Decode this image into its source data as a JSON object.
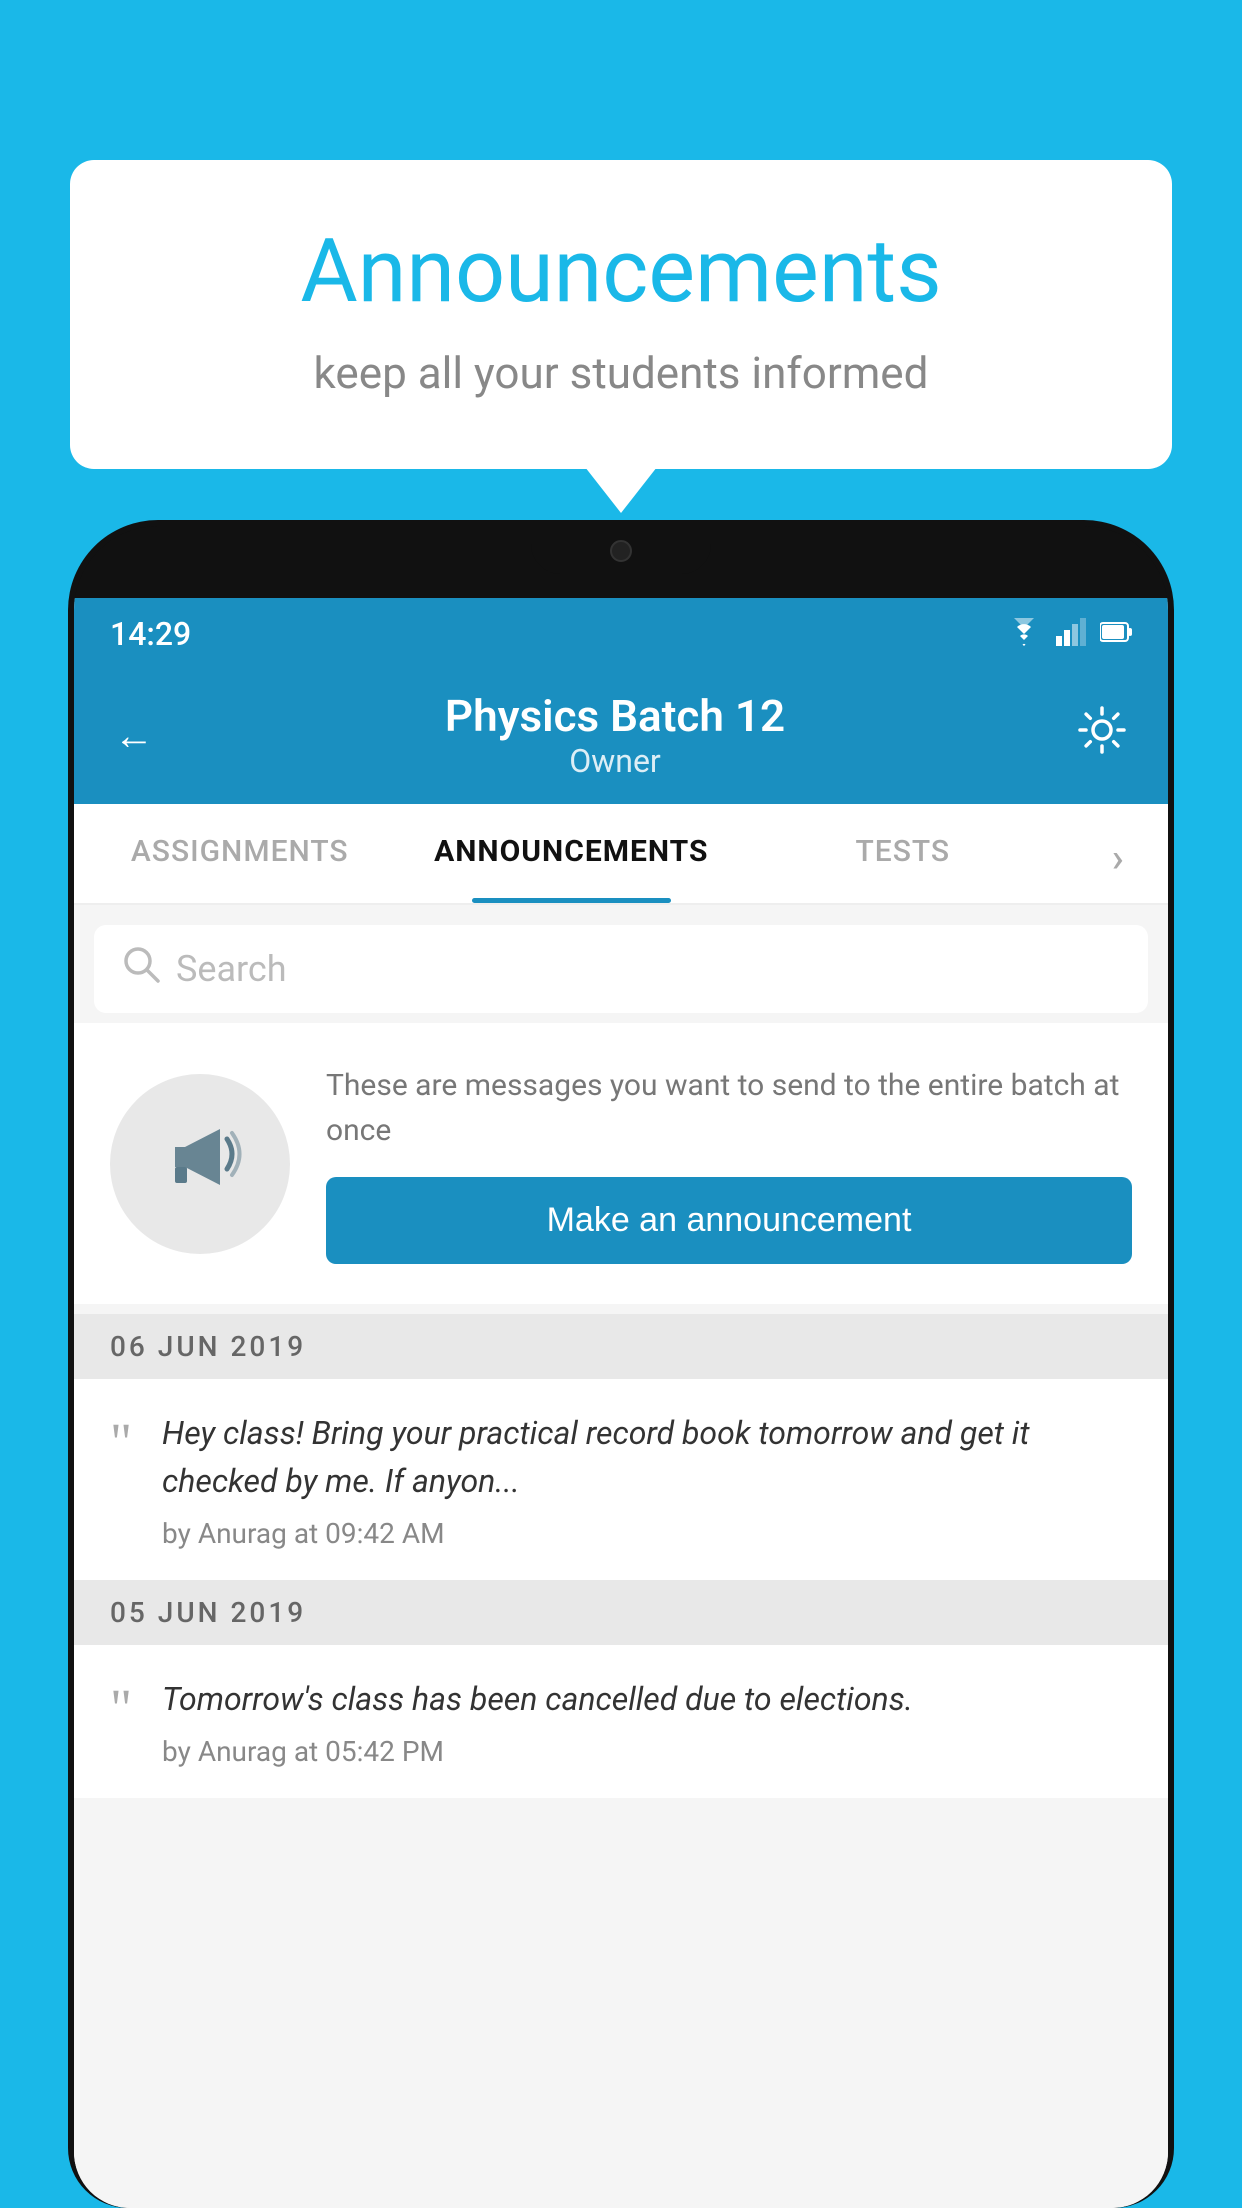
{
  "bubble": {
    "title": "Announcements",
    "subtitle": "keep all your students informed"
  },
  "statusBar": {
    "time": "14:29",
    "wifi": "▾",
    "signal": "◂",
    "battery": "▮"
  },
  "header": {
    "title": "Physics Batch 12",
    "subtitle": "Owner",
    "backLabel": "←",
    "settingsLabel": "⚙"
  },
  "tabs": [
    {
      "label": "ASSIGNMENTS",
      "active": false
    },
    {
      "label": "ANNOUNCEMENTS",
      "active": true
    },
    {
      "label": "TESTS",
      "active": false
    },
    {
      "label": "•",
      "active": false
    }
  ],
  "search": {
    "placeholder": "Search"
  },
  "announcementCard": {
    "description": "These are messages you want to send to the entire batch at once",
    "buttonLabel": "Make an announcement"
  },
  "entries": [
    {
      "date": "06  JUN  2019",
      "text": "Hey class! Bring your practical record book tomorrow and get it checked by me. If anyon...",
      "meta": "by Anurag at 09:42 AM"
    },
    {
      "date": "05  JUN  2019",
      "text": "Tomorrow's class has been cancelled due to elections.",
      "meta": "by Anurag at 05:42 PM"
    }
  ]
}
